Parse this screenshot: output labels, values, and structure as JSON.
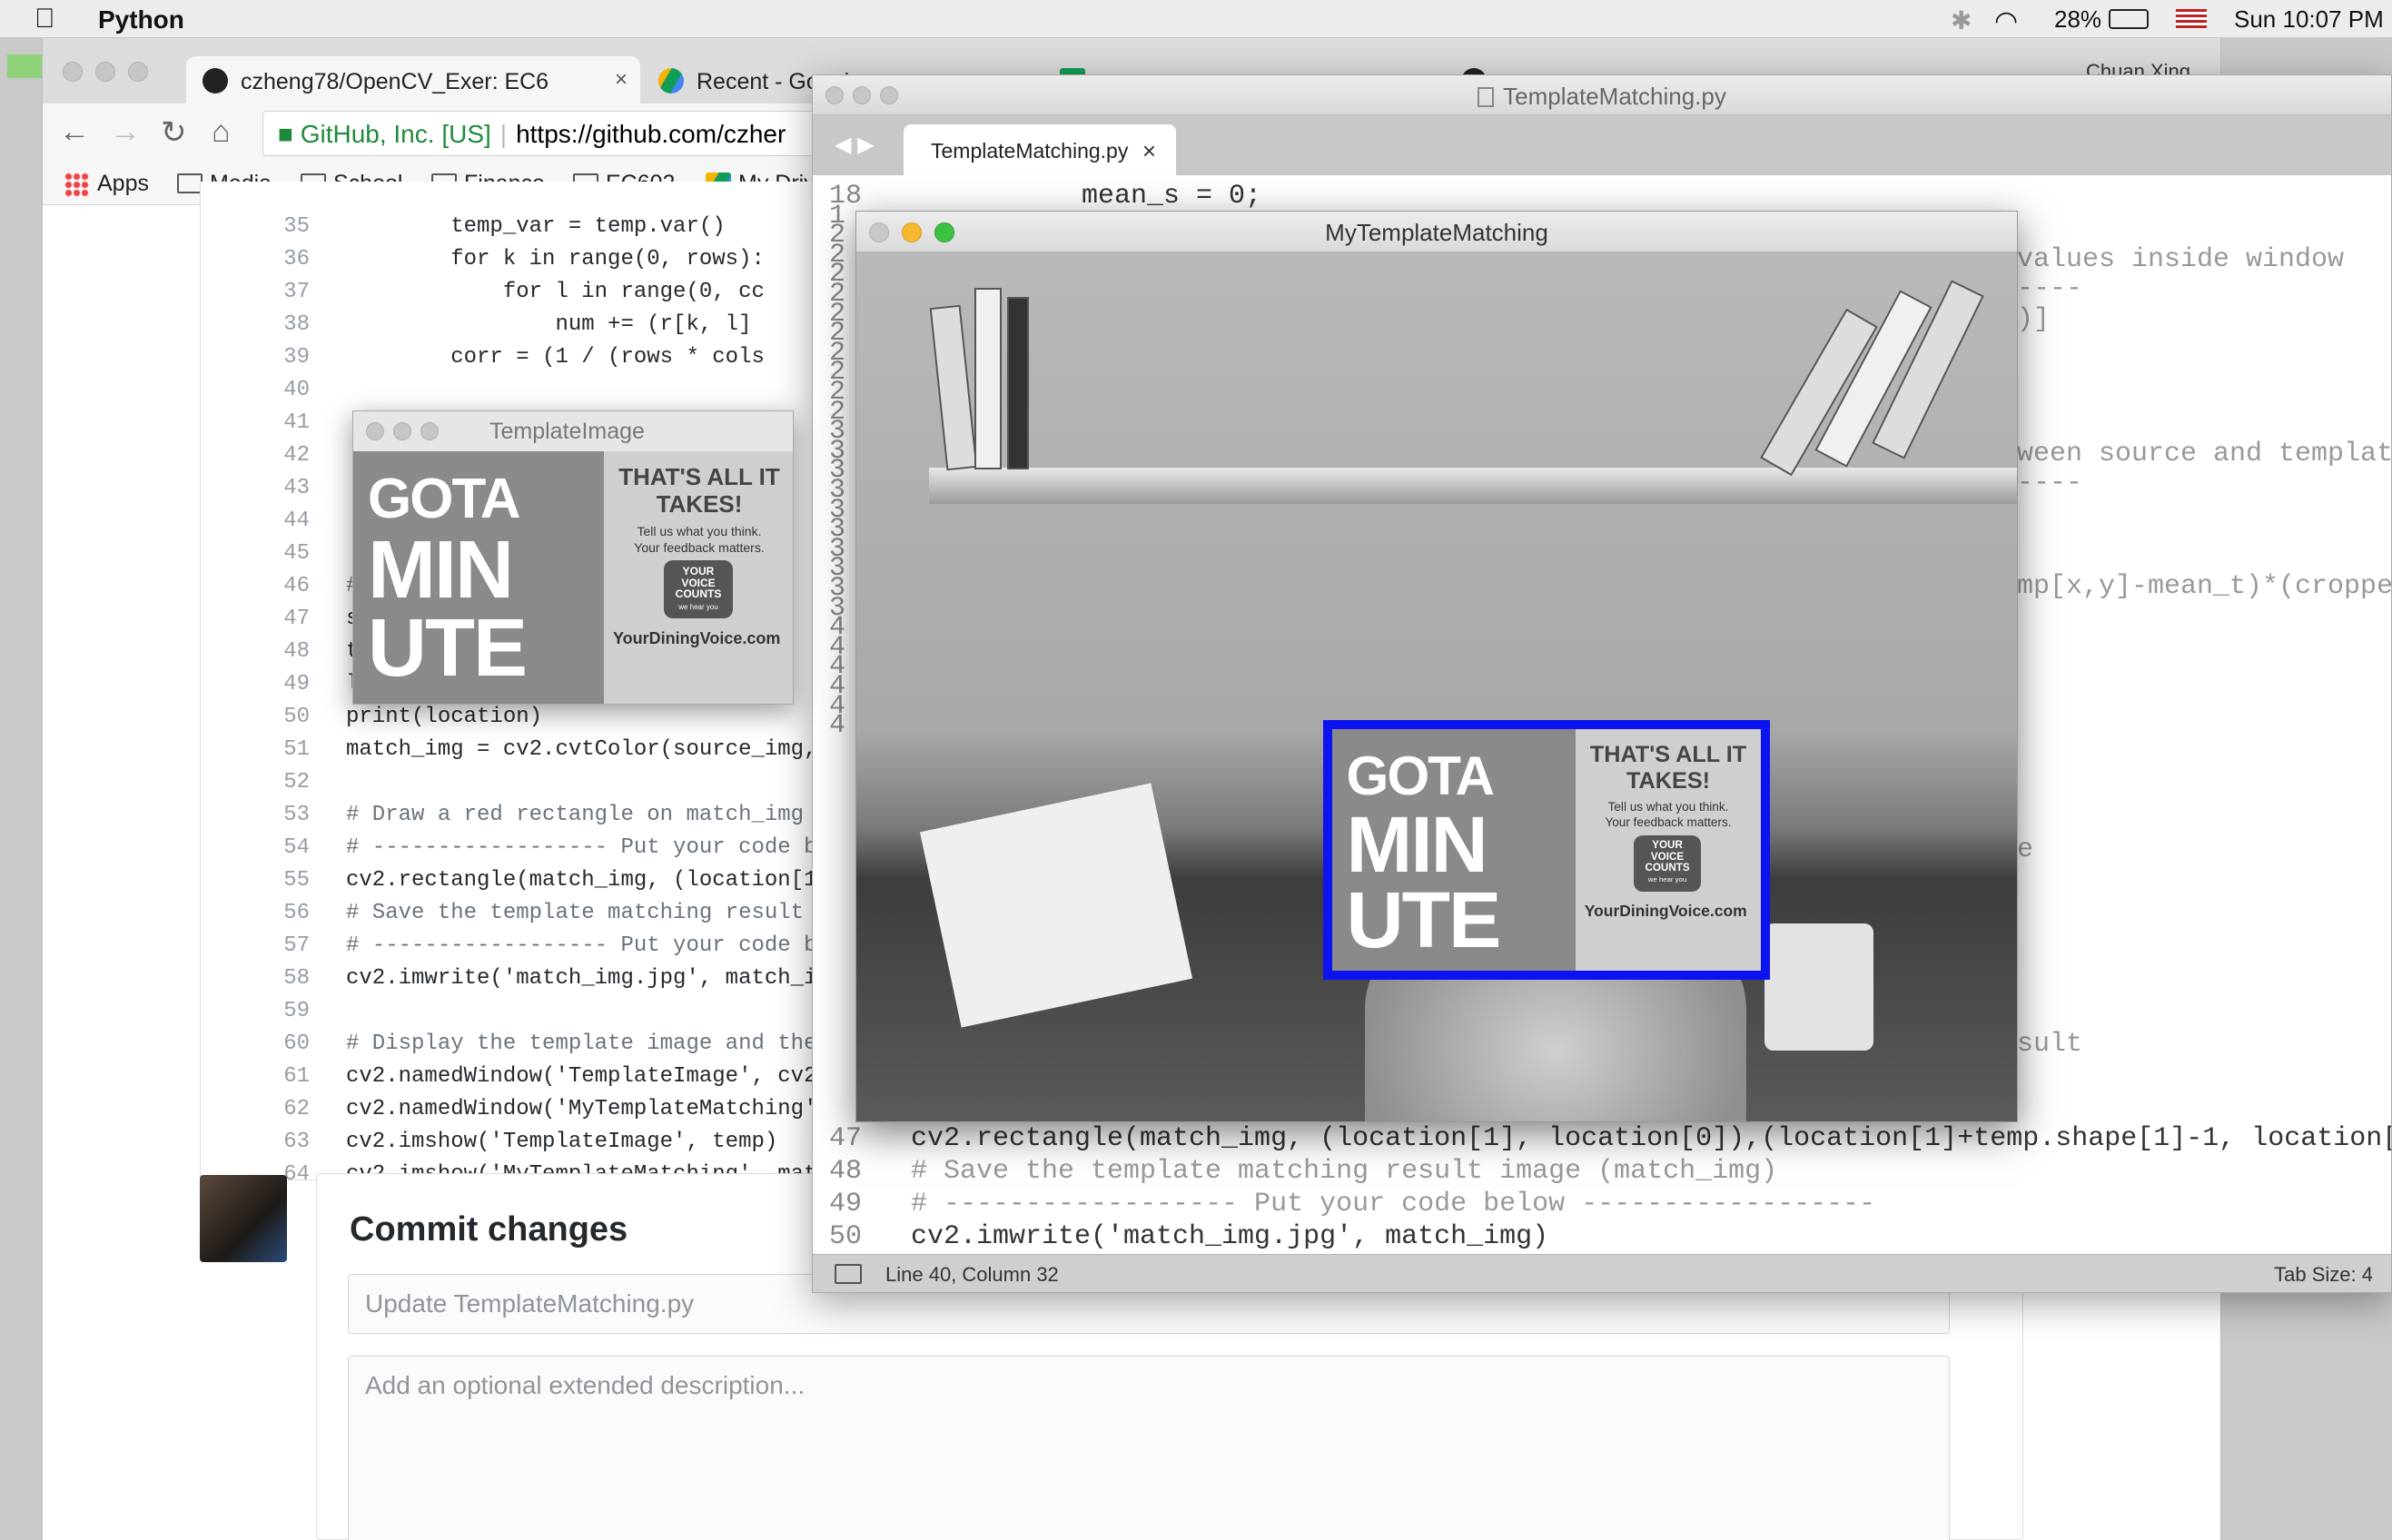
{
  "menubar": {
    "app_name": "Python",
    "battery": "28%",
    "clock": "Sun 10:07 PM"
  },
  "chrome": {
    "tabs": [
      {
        "label": "czheng78/OpenCV_Exer: EC6",
        "close": "×"
      },
      {
        "label": "Recent - Googl",
        "close": ""
      },
      {
        "label": "",
        "close": ""
      },
      {
        "label": "",
        "close": ""
      }
    ],
    "profile": "Chuan Xing",
    "omnibox": {
      "org": "GitHub, Inc. [US]",
      "url": "https://github.com/czher"
    },
    "bookmarks": [
      "Apps",
      "Media",
      "School",
      "Finance",
      "EC602",
      "My Driv"
    ]
  },
  "github_code": {
    "lines": [
      {
        "n": "35",
        "t": "        temp_var = temp.var()"
      },
      {
        "n": "36",
        "t": "        for k in range(0, rows):"
      },
      {
        "n": "37",
        "t": "            for l in range(0, cc"
      },
      {
        "n": "38",
        "t": "                num += (r[k, l]"
      },
      {
        "n": "39",
        "t": "        corr = (1 / (rows * cols"
      },
      {
        "n": "40",
        "t": ""
      },
      {
        "n": "41",
        "t": ""
      },
      {
        "n": "42",
        "t": ""
      },
      {
        "n": "43",
        "t": ""
      },
      {
        "n": "44",
        "t": ""
      },
      {
        "n": "45",
        "t": ""
      },
      {
        "n": "46",
        "t": "#"
      },
      {
        "n": "47",
        "t": "s                     g."
      },
      {
        "n": "48",
        "t": "t                     g'"
      },
      {
        "n": "49",
        "t": "l                      _i"
      },
      {
        "n": "50",
        "t": "print(location)"
      },
      {
        "n": "51",
        "t": "match_img = cv2.cvtColor(source_img,"
      },
      {
        "n": "52",
        "t": ""
      },
      {
        "n": "53",
        "t": "# Draw a red rectangle on match_img"
      },
      {
        "n": "54",
        "t": "# ------------------ Put your code b"
      },
      {
        "n": "55",
        "t": "cv2.rectangle(match_img, (location[1"
      },
      {
        "n": "56",
        "t": "# Save the template matching result"
      },
      {
        "n": "57",
        "t": "# ------------------ Put your code b"
      },
      {
        "n": "58",
        "t": "cv2.imwrite('match_img.jpg', match_i"
      },
      {
        "n": "59",
        "t": ""
      },
      {
        "n": "60",
        "t": "# Display the template image and the"
      },
      {
        "n": "61",
        "t": "cv2.namedWindow('TemplateImage', cv2"
      },
      {
        "n": "62",
        "t": "cv2.namedWindow('MyTemplateMatching'"
      },
      {
        "n": "63",
        "t": "cv2.imshow('TemplateImage', temp)"
      },
      {
        "n": "64",
        "t": "cv2.imshow('MyTemplateMatching', mat"
      }
    ]
  },
  "commit": {
    "title": "Commit changes",
    "summary_placeholder": "Update TemplateMatching.py",
    "description_placeholder": "Add an optional extended description..."
  },
  "sublime": {
    "window_title": "TemplateMatching.py",
    "tab_label": "TemplateMatching.py",
    "tab_close": "×",
    "line18": "mean_s = 0;",
    "right_fragments": [
      "values inside window",
      "----",
      ")]",
      "ween source and templat",
      "----",
      "mp[x,y]-mean_t)*(croppe",
      "e",
      "sult"
    ],
    "gutter_left": [
      "18",
      "1",
      "2",
      "2",
      "2",
      "2",
      "2",
      "2",
      "2",
      "2",
      "2",
      "2",
      "3",
      "3",
      "3",
      "3",
      "3",
      "3",
      "3",
      "3",
      "3",
      "3",
      "4",
      "4",
      "4",
      "4",
      "4",
      "4"
    ],
    "bottom_lines": [
      {
        "n": "47",
        "t": "cv2.rectangle(match_img, (location[1], location[0]),(location[1]+temp.shape[1]-1, location["
      },
      {
        "n": "48",
        "t": "# Save the template matching result image (match_img)"
      },
      {
        "n": "49",
        "t": "# ------------------ Put your code below ------------------"
      },
      {
        "n": "50",
        "t": "cv2.imwrite('match_img.jpg', match_img)"
      }
    ],
    "status": {
      "position": "Line 40, Column 32",
      "tab_size": "Tab Size: 4"
    }
  },
  "template_window": {
    "title": "TemplateImage"
  },
  "match_window": {
    "title": "MyTemplateMatching",
    "box_color": "#0b14f0"
  },
  "card": {
    "big1": "GOTA",
    "big2": "MIN",
    "big3": "UTE",
    "headline1": "THAT'S ALL IT",
    "headline2": "TAKES!",
    "sub1": "Tell us what you think.",
    "sub2": "Your feedback matters.",
    "badge1": "YOUR",
    "badge2": "VOICE",
    "badge3": "COUNTS",
    "badge4": "we hear you",
    "url": "YourDiningVoice.com"
  }
}
